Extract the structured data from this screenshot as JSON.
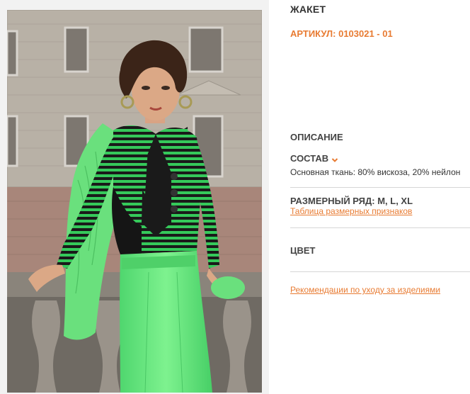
{
  "product": {
    "title": "ЖАКЕТ",
    "article": "АРТИКУЛ: 0103021 - 01",
    "description_label": "ОПИСАНИЕ",
    "composition_label": "СОСТАВ",
    "composition_value": "Основная ткань: 80% вискоза, 20% нейлон",
    "size_range": "РАЗМЕРНЫЙ РЯД: M, L, XL",
    "size_table_link": "Таблица размерных признаков",
    "color_label": "ЦВЕТ",
    "care_link": "Рекомендации по уходу за изделиями"
  },
  "colors": {
    "accent": "#e87b32",
    "garment_green": "#5fe07a",
    "stripe_black": "#111111"
  },
  "icons": {
    "composition_toggle": "chevron-down-icon"
  }
}
